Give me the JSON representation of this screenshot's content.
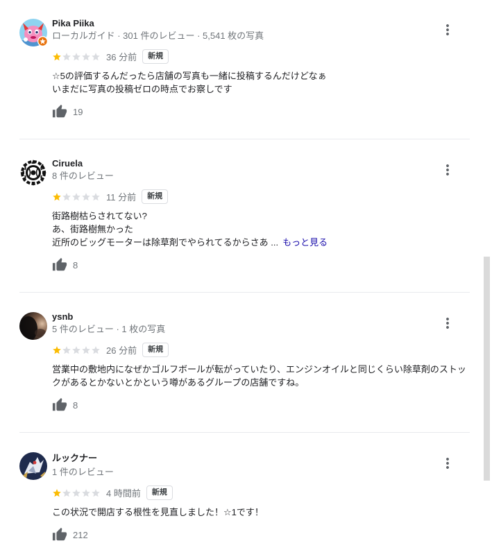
{
  "reviews": [
    {
      "author": "Pika Piika",
      "meta": "ローカルガイド · 301 件のレビュー · 5,541 枚の写真",
      "local_guide": true,
      "rating": 1,
      "max_rating": 5,
      "time": "36 分前",
      "badge": "新規",
      "lines": [
        "☆5の評価するんだったら店舗の写真も一緒に投稿するんだけどなぁ",
        "いまだに写真の投稿ゼロの時点でお察しです"
      ],
      "likes": "19"
    },
    {
      "author": "Ciruela",
      "meta": "8 件のレビュー",
      "local_guide": false,
      "rating": 1,
      "max_rating": 5,
      "time": "11 分前",
      "badge": "新規",
      "lines": [
        "街路樹枯らされてない?",
        "あ、街路樹無かった",
        "近所のビッグモーターは除草剤でやられてるからさあ ..."
      ],
      "more_label": "もっと見る",
      "likes": "8"
    },
    {
      "author": "ysnb",
      "meta": "5 件のレビュー · 1 枚の写真",
      "local_guide": false,
      "rating": 1,
      "max_rating": 5,
      "time": "26 分前",
      "badge": "新規",
      "lines": [
        "営業中の敷地内になぜかゴルフボールが転がっていたり、エンジンオイルと同じくらい除草剤のストックがあるとかないとかという噂があるグループの店舗ですね。"
      ],
      "likes": "8"
    },
    {
      "author": "ルックナー",
      "meta": "1 件のレビュー",
      "local_guide": false,
      "rating": 1,
      "max_rating": 5,
      "time": "4 時間前",
      "badge": "新規",
      "lines": [
        "この状況で開店する根性を見直しました！☆1です！"
      ],
      "likes": "212"
    }
  ],
  "icons": {
    "like": "thumbs-up-icon",
    "menu": "more-vert-icon",
    "rating": "star-icon",
    "local_guide": "local-guide-badge-icon"
  },
  "colors": {
    "star_filled": "#fbbc04",
    "star_empty": "#dadce0",
    "link": "#1a0dab",
    "local_guide": "#e8710a",
    "icon": "#5f6368"
  }
}
